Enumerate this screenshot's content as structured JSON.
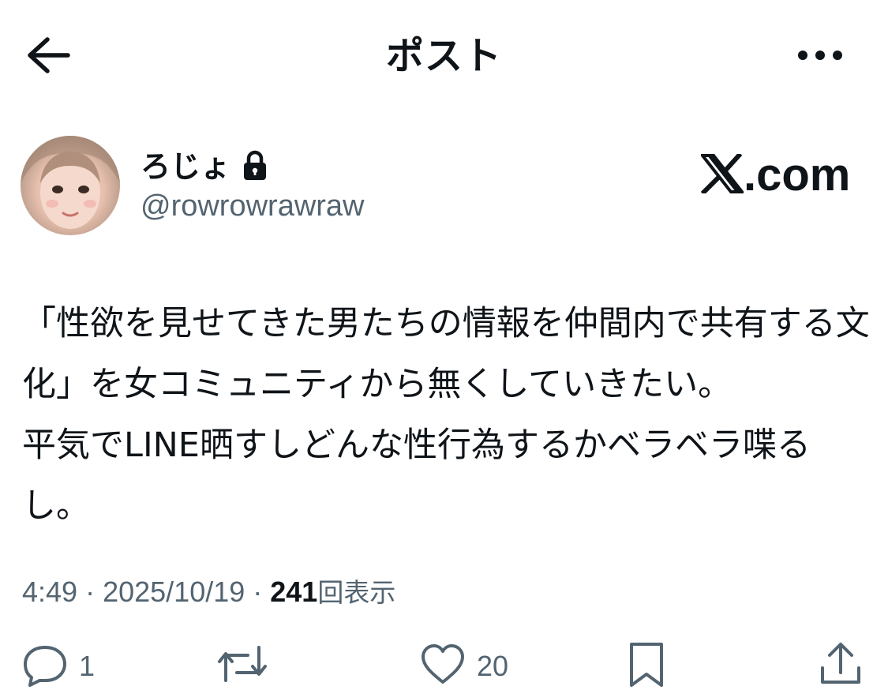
{
  "header": {
    "title": "ポスト",
    "back_icon": "arrow-left-icon",
    "more_icon": "more-horizontal-icon"
  },
  "author": {
    "display_name": "ろじょ",
    "handle": "@rowrowrawraw",
    "protected": true
  },
  "watermark": {
    "text": ".com"
  },
  "tweet": {
    "text": "「性欲を見せてきた男たちの情報を仲間内で共有する文化」を女コミュニティから無くしていきたい。\n平気でLINE晒すしどんな性行為するかベラベラ喋るし。"
  },
  "meta": {
    "time": "4:49",
    "sep1": " · ",
    "date": "2025/10/19",
    "sep2": " · ",
    "views_count": "241",
    "views_label": "回表示"
  },
  "actions": {
    "reply_count": "1",
    "repost_count": "",
    "like_count": "20",
    "bookmark_count": ""
  },
  "colors": {
    "text_primary": "#0f1419",
    "text_secondary": "#536471",
    "background": "#ffffff"
  }
}
